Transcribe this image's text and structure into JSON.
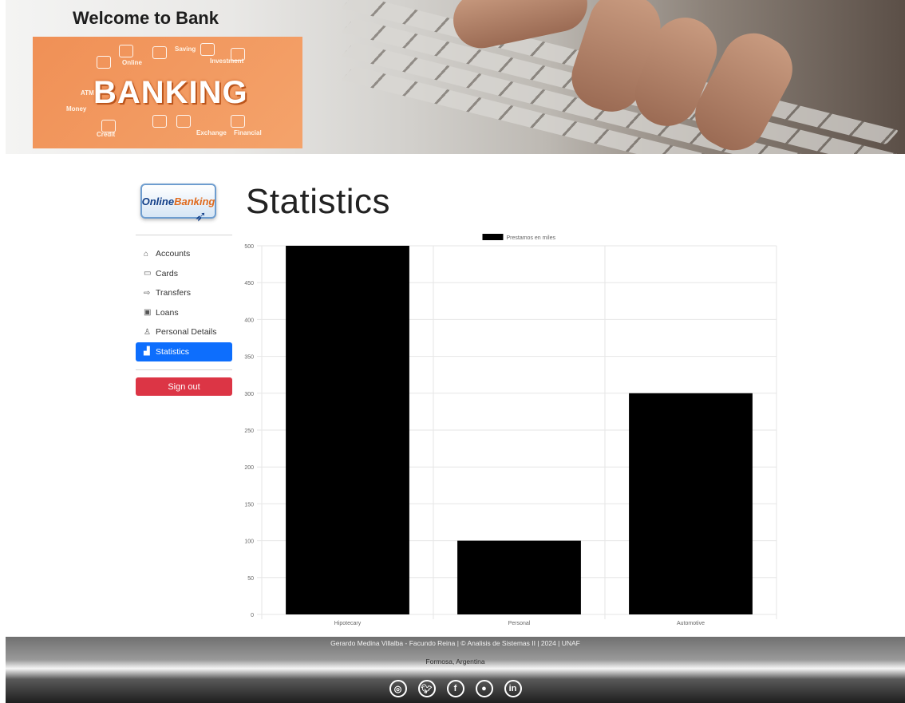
{
  "header": {
    "welcome": "Welcome to Bank",
    "banner": {
      "title": "BANKING",
      "labels": [
        "Online",
        "Saving",
        "Investment",
        "Money",
        "ATM",
        "Credit",
        "Exchange",
        "Financial"
      ]
    }
  },
  "sidebar": {
    "logo": {
      "part1": "Online",
      "part2": "Banking"
    },
    "items": [
      {
        "label": "Accounts",
        "icon": "bank-icon"
      },
      {
        "label": "Cards",
        "icon": "credit-card-icon"
      },
      {
        "label": "Transfers",
        "icon": "transfer-arrow-icon"
      },
      {
        "label": "Loans",
        "icon": "cash-icon"
      },
      {
        "label": "Personal Details",
        "icon": "person-icon"
      },
      {
        "label": "Statistics",
        "icon": "bar-chart-icon",
        "active": true
      }
    ],
    "signout": "Sign out"
  },
  "main": {
    "title": "Statistics"
  },
  "chart_data": {
    "type": "bar",
    "categories": [
      "Hipotecary",
      "Personal",
      "Automotive"
    ],
    "series": [
      {
        "name": "Prestamos en miles",
        "values": [
          500,
          100,
          300
        ],
        "color": "#000000"
      }
    ],
    "ylim": [
      0,
      500
    ],
    "yticks": [
      0,
      50,
      100,
      150,
      200,
      250,
      300,
      350,
      400,
      450,
      500
    ],
    "grid": true,
    "legend": "top-center"
  },
  "footer": {
    "credits": "Gerardo Medina Villalba - Facundo Reina | © Analisis de Sistemas II | 2024 | UNAF",
    "location": "Formosa, Argentina",
    "socials": [
      {
        "name": "instagram",
        "glyph": "◎"
      },
      {
        "name": "twitter",
        "glyph": "🐦︎"
      },
      {
        "name": "facebook",
        "glyph": "f"
      },
      {
        "name": "github",
        "glyph": "●"
      },
      {
        "name": "linkedin",
        "glyph": "in"
      }
    ]
  },
  "colors": {
    "primary": "#0d6efd",
    "danger": "#dc3545",
    "banner": "#f09056"
  }
}
